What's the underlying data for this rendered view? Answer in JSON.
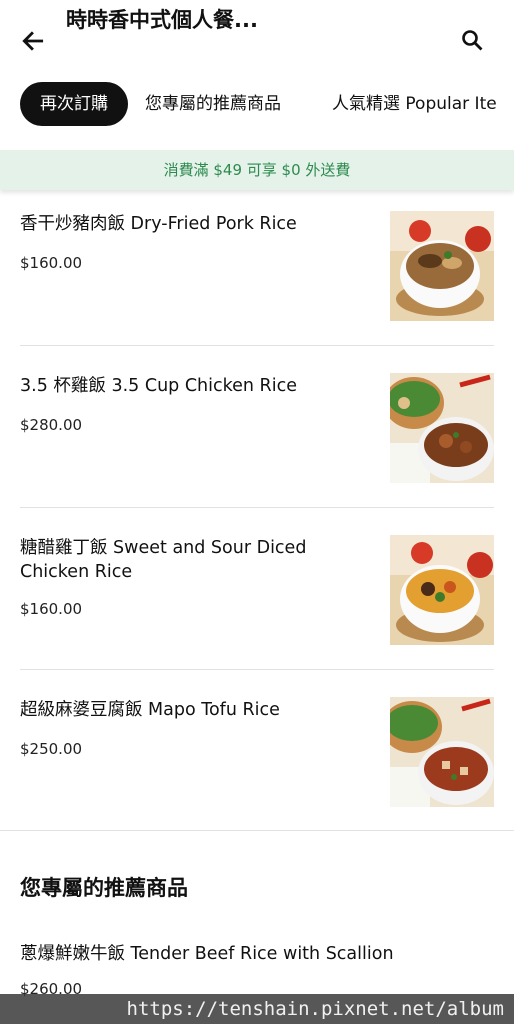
{
  "header": {
    "title": "時時香中式個人餐...",
    "back_icon": "arrow-left-icon",
    "search_icon": "search-icon"
  },
  "tabs": [
    {
      "label": "再次訂購",
      "active": true
    },
    {
      "label": "您專屬的推薦商品",
      "active": false
    },
    {
      "label": "人氣精選 Popular Ite",
      "active": false
    }
  ],
  "promo": {
    "text": "消費滿 $49 可享 $0 外送費"
  },
  "items": [
    {
      "name": "香干炒豬肉飯 Dry-Fried Pork Rice",
      "price": "$160.00"
    },
    {
      "name": "3.5 杯雞飯 3.5 Cup Chicken Rice",
      "price": "$280.00"
    },
    {
      "name": "糖醋雞丁飯 Sweet and Sour Diced Chicken Rice",
      "price": "$160.00"
    },
    {
      "name": "超級麻婆豆腐飯 Mapo Tofu Rice",
      "price": "$250.00"
    }
  ],
  "section": {
    "title": "您專屬的推薦商品",
    "item": {
      "name": "蔥爆鮮嫩牛飯 Tender Beef Rice with Scallion",
      "price": "$260.00"
    }
  },
  "watermark": "https://tenshain.pixnet.net/album"
}
